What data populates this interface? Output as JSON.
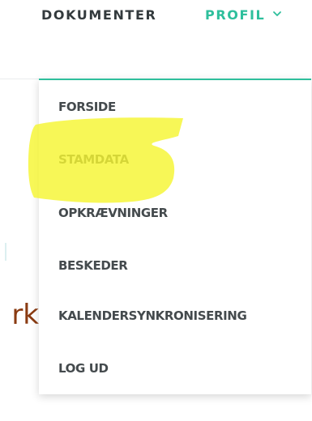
{
  "nav": {
    "documents_label": "DOKUMENTER",
    "profile_label": "PROFIL"
  },
  "dropdown": {
    "items": [
      {
        "label": "FORSIDE"
      },
      {
        "label": "STAMDATA"
      },
      {
        "label": "OPKRÆVNINGER"
      },
      {
        "label": "BESKEDER"
      },
      {
        "label": "KALENDERSYNKRONISERING"
      },
      {
        "label": "LOG UD"
      }
    ]
  },
  "background": {
    "partial_text": "rk"
  },
  "colors": {
    "accent": "#2ebf9c",
    "nav_text": "#333a3d",
    "menu_text": "#444a4d",
    "highlighter": "#f5f532",
    "background_text": "#8a3b12"
  },
  "icons": {
    "profile_chevron": "chevron-down-icon"
  }
}
